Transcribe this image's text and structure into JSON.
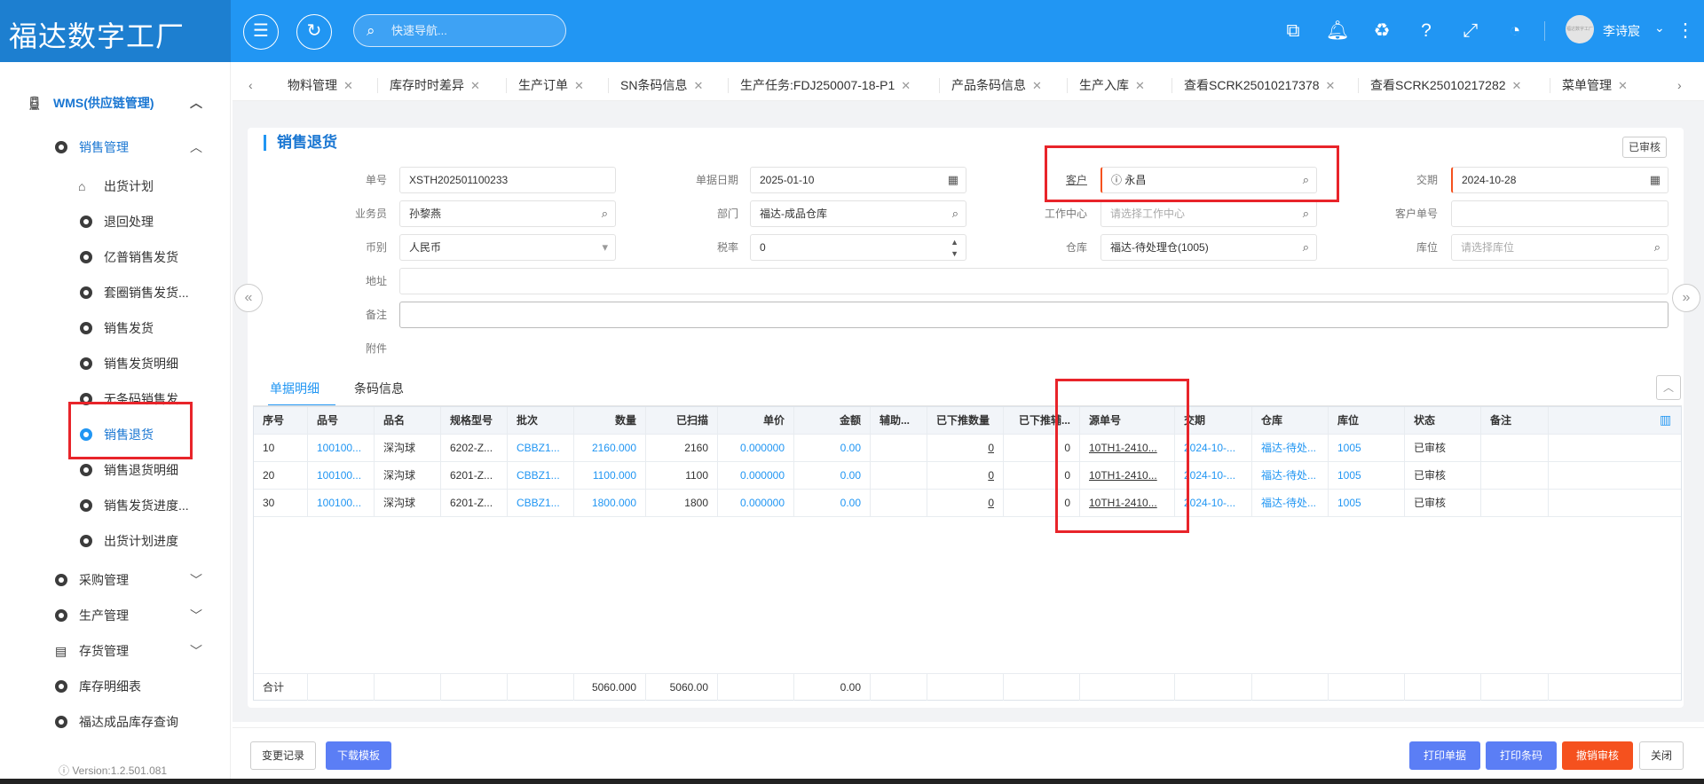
{
  "app": {
    "title": "福达数字工厂"
  },
  "header": {
    "search_placeholder": "快速导航...",
    "user_name": "李诗宸",
    "avatar_text": "福达数字工厂"
  },
  "sidebar": {
    "group": "WMS(供应链管理)",
    "sub": "销售管理",
    "items": [
      "出货计划",
      "退回处理",
      "亿普销售发货",
      "套圈销售发货...",
      "销售发货",
      "销售发货明细",
      "无条码销售发...",
      "销售退货",
      "销售退货明细",
      "销售发货进度...",
      "出货计划进度"
    ],
    "sections": [
      "采购管理",
      "生产管理",
      "存货管理",
      "库存明细表",
      "福达成品库存查询"
    ],
    "version": "Version:1.2.501.081"
  },
  "tabs": [
    "物料管理",
    "库存时时差异",
    "生产订单",
    "SN条码信息",
    "生产任务:FDJ250007-18-P1",
    "产品条码信息",
    "生产入库",
    "查看SCRK25010217378",
    "查看SCRK25010217282",
    "菜单管理"
  ],
  "page": {
    "title": "销售退货",
    "status": "已审核"
  },
  "form": {
    "labels": {
      "no": "单号",
      "date": "单据日期",
      "customer": "客户",
      "delivery": "交期",
      "salesman": "业务员",
      "dept": "部门",
      "workcenter": "工作中心",
      "cust_no": "客户单号",
      "currency": "币别",
      "tax": "税率",
      "warehouse": "仓库",
      "location": "库位",
      "address": "地址",
      "remark": "备注",
      "attach": "附件"
    },
    "values": {
      "no": "XSTH202501100233",
      "date": "2025-01-10",
      "customer": "永昌",
      "delivery": "2024-10-28",
      "salesman": "孙黎燕",
      "dept": "福达-成品仓库",
      "currency": "人民币",
      "tax": "0",
      "warehouse": "福达-待处理仓(1005)"
    },
    "placeholders": {
      "workcenter": "请选择工作中心",
      "location": "请选择库位"
    }
  },
  "detail_tabs": [
    "单据明细",
    "条码信息"
  ],
  "table": {
    "headers": [
      "序号",
      "品号",
      "品名",
      "规格型号",
      "批次",
      "数量",
      "已扫描",
      "单价",
      "金额",
      "辅助...",
      "已下推数量",
      "已下推辅...",
      "源单号",
      "交期",
      "仓库",
      "库位",
      "状态",
      "备注"
    ],
    "rows": [
      [
        "10",
        "100100...",
        "深沟球",
        "6202-Z...",
        "CBBZ1...",
        "2160.000",
        "2160",
        "0.000000",
        "0.00",
        "",
        "0",
        "0",
        "10TH1-2410...",
        "2024-10-...",
        "福达-待处...",
        "1005",
        "已审核",
        ""
      ],
      [
        "20",
        "100100...",
        "深沟球",
        "6201-Z...",
        "CBBZ1...",
        "1100.000",
        "1100",
        "0.000000",
        "0.00",
        "",
        "0",
        "0",
        "10TH1-2410...",
        "2024-10-...",
        "福达-待处...",
        "1005",
        "已审核",
        ""
      ],
      [
        "30",
        "100100...",
        "深沟球",
        "6201-Z...",
        "CBBZ1...",
        "1800.000",
        "1800",
        "0.000000",
        "0.00",
        "",
        "0",
        "0",
        "10TH1-2410...",
        "2024-10-...",
        "福达-待处...",
        "1005",
        "已审核",
        ""
      ]
    ],
    "total": {
      "label": "合计",
      "qty": "5060.000",
      "scanned": "5060.00",
      "amount": "0.00"
    }
  },
  "buttons": {
    "change_log": "变更记录",
    "download_tpl": "下载模板",
    "print_doc": "打印单据",
    "print_barcode": "打印条码",
    "revoke": "撤销审核",
    "close": "关闭"
  },
  "colors": {
    "primary": "#2196f3",
    "danger": "#f5511e",
    "highlight": "#e8242a"
  }
}
